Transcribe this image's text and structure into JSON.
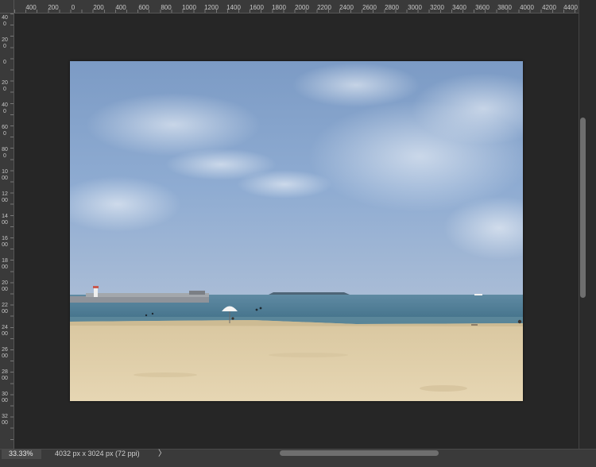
{
  "ruler_top": {
    "ticks": [
      "400",
      "200",
      "0",
      "200",
      "400",
      "600",
      "800",
      "1000",
      "1200",
      "1400",
      "1600",
      "1800",
      "2000",
      "2200",
      "2400",
      "2600",
      "2800",
      "3000",
      "3200",
      "3400",
      "3600",
      "3800",
      "4000",
      "4200",
      "4400"
    ]
  },
  "ruler_left": {
    "ticks": [
      "400",
      "200",
      "0",
      "200",
      "400",
      "600",
      "800",
      "1000",
      "1200",
      "1400",
      "1600",
      "1800",
      "2000",
      "2200",
      "2400",
      "2600",
      "2800",
      "3000",
      "3200"
    ]
  },
  "document": {
    "description_free": true
  },
  "status": {
    "zoom": "33.33%",
    "info": "4032 px x 3024 px (72 ppi)",
    "arrow_icon": "chevron-right-icon",
    "arrow_glyph": "〉"
  },
  "colors": {
    "canvas_bg": "#262626",
    "ruler_bg": "#3a3a3a",
    "sky_top": "#7f9cc4",
    "sea": "#4d7990",
    "sand": "#e0cfaa"
  }
}
